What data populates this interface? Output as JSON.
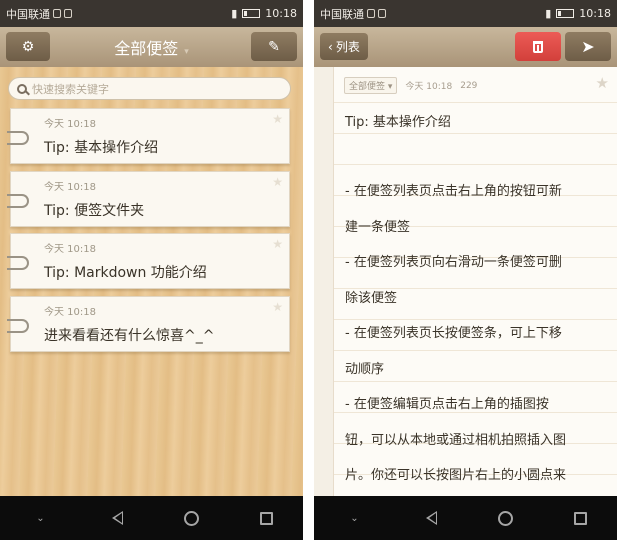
{
  "status": {
    "carrier": "中国联通",
    "time": "10:18"
  },
  "left": {
    "title": "全部便签",
    "search_placeholder": "快速搜索关键字",
    "notes": [
      {
        "time": "今天 10:18",
        "title": "Tip: 基本操作介绍"
      },
      {
        "time": "今天 10:18",
        "title": "Tip: 便签文件夹"
      },
      {
        "time": "今天 10:18",
        "title": "Tip: Markdown 功能介绍"
      },
      {
        "time": "今天 10:18",
        "title": "进来看看还有什么惊喜^_^"
      }
    ]
  },
  "right": {
    "back_label": "列表",
    "folder": "全部便签",
    "meta_time": "今天 10:18",
    "char_count": "229",
    "lines": [
      "Tip: 基本操作介绍",
      "",
      "- 在便签列表页点击右上角的按钮可新",
      "建一条便签",
      "- 在便签列表页向右滑动一条便签可删",
      "除该便签",
      "- 在便签列表页长按便签条，可上下移",
      "动顺序",
      "- 在便签编辑页点击右上角的插图按",
      "钮，可以从本地或通过相机拍照插入图",
      "片。你还可以长按图片右上的小圆点来"
    ]
  },
  "colors": {
    "accent_red": "#d2403b",
    "toolbar": "#a99478",
    "wood": "#e6c28c"
  },
  "icons": [
    "gear-icon",
    "compose-icon",
    "search-icon",
    "star-icon",
    "clip-icon",
    "trash-icon",
    "send-icon",
    "chevron-left-icon",
    "back-icon",
    "home-icon",
    "recent-apps-icon"
  ]
}
